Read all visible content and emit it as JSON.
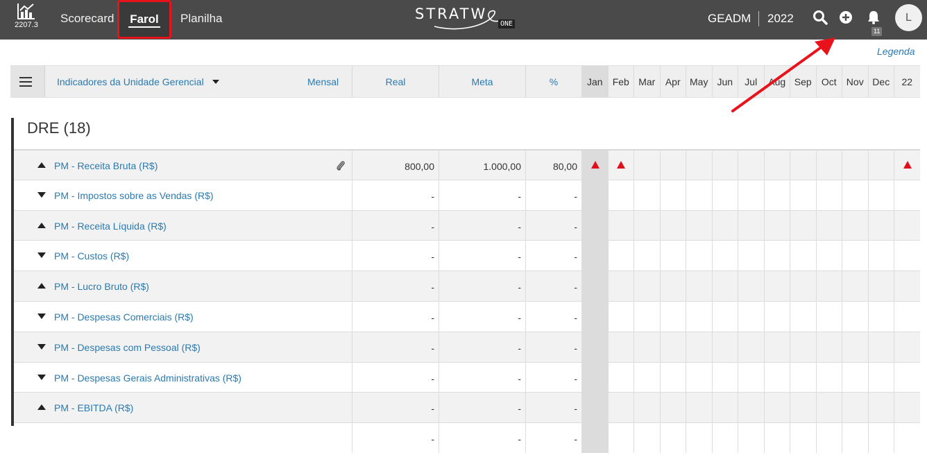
{
  "topbar": {
    "version": "2207.3",
    "nav": [
      "Scorecard",
      "Farol",
      "Planilha"
    ],
    "brand": "STRATW",
    "brand_suffix": "ONE",
    "org": "GEADM",
    "year": "2022",
    "notifications": "11",
    "avatar_initial": "L"
  },
  "legend_link": "Legenda",
  "header": {
    "selector": "Indicadores da Unidade Gerencial",
    "period": "Mensal",
    "real": "Real",
    "meta": "Meta",
    "pct": "%",
    "months": [
      "Jan",
      "Feb",
      "Mar",
      "Apr",
      "May",
      "Jun",
      "Jul",
      "Aug",
      "Sep",
      "Oct",
      "Nov",
      "Dec",
      "22"
    ]
  },
  "section": {
    "title": "DRE (18)"
  },
  "rows": [
    {
      "name": "PM - Receita Bruta (R$)",
      "dir": "up",
      "real": "800,00",
      "meta": "1.000,00",
      "pct": "80,00",
      "attachment": true,
      "status": [
        "red-up",
        "red-up",
        "",
        "",
        "",
        "",
        "",
        "",
        "",
        "",
        "",
        "",
        "red-up"
      ]
    },
    {
      "name": "PM - Impostos sobre as Vendas (R$)",
      "dir": "down",
      "real": "-",
      "meta": "-",
      "pct": "-"
    },
    {
      "name": "PM - Receita Líquida (R$)",
      "dir": "up",
      "real": "-",
      "meta": "-",
      "pct": "-"
    },
    {
      "name": "PM - Custos (R$)",
      "dir": "down",
      "real": "-",
      "meta": "-",
      "pct": "-"
    },
    {
      "name": "PM - Lucro Bruto (R$)",
      "dir": "up",
      "real": "-",
      "meta": "-",
      "pct": "-"
    },
    {
      "name": "PM - Despesas Comerciais (R$)",
      "dir": "down",
      "real": "-",
      "meta": "-",
      "pct": "-"
    },
    {
      "name": "PM - Despesas com Pessoal (R$)",
      "dir": "down",
      "real": "-",
      "meta": "-",
      "pct": "-"
    },
    {
      "name": "PM - Despesas Gerais Administrativas (R$)",
      "dir": "down",
      "real": "-",
      "meta": "-",
      "pct": "-"
    },
    {
      "name": "PM - EBITDA (R$)",
      "dir": "up",
      "real": "-",
      "meta": "-",
      "pct": "-"
    },
    {
      "name": "",
      "dir": "",
      "real": "-",
      "meta": "-",
      "pct": "-"
    }
  ],
  "colors": {
    "topbar": "#4a4a4a",
    "link": "#2a7ab0",
    "status_red": "#e0101a",
    "highlight": "#e8131a"
  }
}
